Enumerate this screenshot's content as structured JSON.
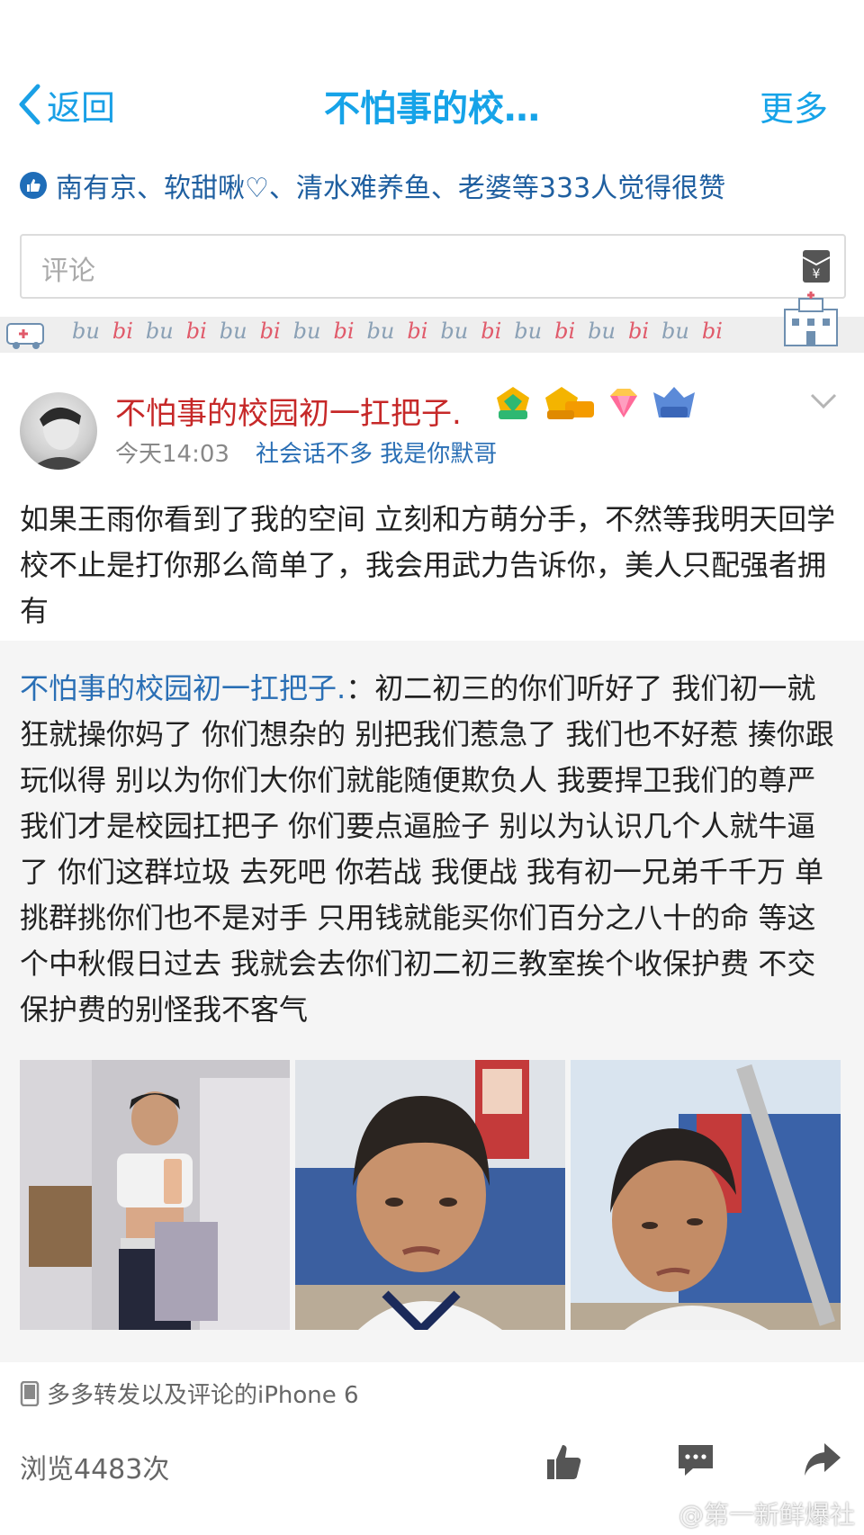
{
  "nav": {
    "back_label": "返回",
    "title": "不怕事的校…",
    "more_label": "更多"
  },
  "likes": {
    "text": "南有京、软甜啾♡、清水难养鱼、老婆等333人觉得很赞"
  },
  "comment": {
    "placeholder": "评论"
  },
  "banner": {
    "words": [
      "bu",
      "bi",
      "bu",
      "bi",
      "bu",
      "bi",
      "bu",
      "bi",
      "bu",
      "bi",
      "bu",
      "bi",
      "bu",
      "bi",
      "bu",
      "bi",
      "bu",
      "bi"
    ]
  },
  "post": {
    "username": "不怕事的校园初一扛把子.",
    "badges": [
      "LV8",
      "LV8年",
      "diamond",
      "148"
    ],
    "time": "今天14:03",
    "signature": "社会话不多 我是你默哥",
    "body": "如果王雨你看到了我的空间 立刻和方萌分手，不然等我明天回学校不止是打你那么简单了，我会用武力告诉你，美人只配强者拥有",
    "quote_author": "不怕事的校园初一扛把子.",
    "quote_sep": "：",
    "quote_text": "初二初三的你们听好了 我们初一就狂就操你妈了 你们想杂的 别把我们惹急了 我们也不好惹 揍你跟玩似得 别以为你们大你们就能随便欺负人 我要捍卫我们的尊严 我们才是校园扛把子 你们要点逼脸子 别以为认识几个人就牛逼了 你们这群垃圾 去死吧 你若战 我便战 我有初一兄弟千千万 单挑群挑你们也不是对手 只用钱就能买你们百分之八十的命 等这个中秋假日过去 我就会去你们初二初三教室挨个收保护费 不交保护费的别怪我不客气",
    "device": "多多转发以及评论的iPhone 6",
    "views": "浏览4483次"
  },
  "watermark": "@第一新鲜爆社",
  "colors": {
    "accent": "#16a3e8",
    "username": "#c62828",
    "link": "#2a6fb5"
  }
}
